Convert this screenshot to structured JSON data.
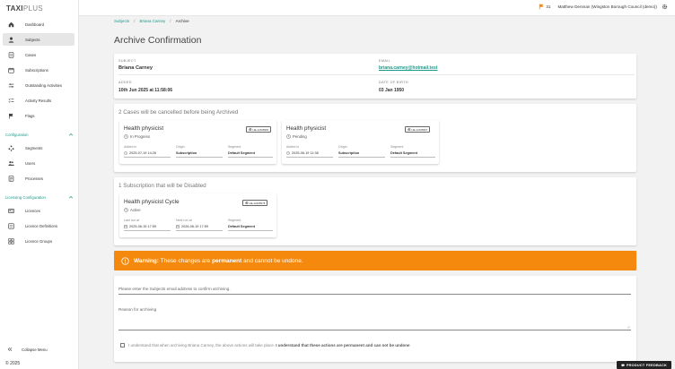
{
  "app": {
    "logo_main": "TAXI",
    "logo_sub": "PLUS",
    "copyright": "© 2025"
  },
  "sidebar": {
    "items": [
      {
        "label": "Dashboard",
        "icon": "home-icon"
      },
      {
        "label": "Subjects",
        "icon": "person-icon",
        "active": true
      },
      {
        "label": "Cases",
        "icon": "folder-icon"
      },
      {
        "label": "Subscriptions",
        "icon": "calendar-icon"
      },
      {
        "label": "Outstanding Activities",
        "icon": "sliders-icon"
      },
      {
        "label": "Activity Results",
        "icon": "list-check-icon"
      },
      {
        "label": "Flags",
        "icon": "flag-icon"
      }
    ],
    "config_section": "Configuration",
    "config_items": [
      {
        "label": "Segments",
        "icon": "segments-icon"
      },
      {
        "label": "Users",
        "icon": "users-icon"
      },
      {
        "label": "Processes",
        "icon": "processes-icon"
      }
    ],
    "licensing_section": "Licensing Configuration",
    "licensing_items": [
      {
        "label": "Licences",
        "icon": "id-card-icon"
      },
      {
        "label": "Licence Definitions",
        "icon": "definitions-icon"
      },
      {
        "label": "Licence Groups",
        "icon": "grid-icon"
      }
    ],
    "collapse_label": "Collapse Menu"
  },
  "topbar": {
    "flag_count": "31",
    "user": "Matthew Denman (Wingston Borough Council (demo))"
  },
  "breadcrumb": {
    "items": [
      "Subjects",
      "Briana Carney",
      "Archive"
    ],
    "sep": "/"
  },
  "page": {
    "title": "Archive Confirmation"
  },
  "subject": {
    "subject_label": "SUBJECT",
    "subject_value": "Briana Carney",
    "email_label": "EMAIL",
    "email_value": "briana.carney@hotmail.test",
    "added_label": "ADDED",
    "added_value": "10th Jun 2025 at 11:58:06",
    "dob_label": "DATE OF BIRTH",
    "dob_value": "03 Jan 1950"
  },
  "cases": {
    "heading": "2 Cases will be cancelled before being Archived",
    "items": [
      {
        "title": "Health physicist",
        "status": "In Progress",
        "id": "HE-12345981",
        "added_label": "Added in",
        "added": "2025-07-19 14:26",
        "origin_label": "Origin",
        "origin": "Subscription",
        "segment_label": "Segment",
        "segment": "Default Segment"
      },
      {
        "title": "Health physicist",
        "status": "Pending",
        "id": "HE-12345967",
        "added_label": "Added in",
        "added": "2025-06-19 11:38",
        "origin_label": "Origin",
        "origin": "Subscription",
        "segment_label": "Segment",
        "segment": "Default Segment"
      }
    ]
  },
  "subscriptions": {
    "heading": "1 Subscription that will be Disabled",
    "items": [
      {
        "title": "Health physicist Cycle",
        "status": "Active",
        "id": "HE-12345678",
        "last_label": "Last run at",
        "last": "2025-06-19 17:59",
        "next_label": "Next run at",
        "next": "2026-06-19 17:59",
        "segment_label": "Segment",
        "segment": "Default Segment"
      }
    ]
  },
  "warning": {
    "prefix": "Warning:",
    "text1": " These changes are ",
    "bold": "permanent",
    "text2": " and cannot be undone."
  },
  "form": {
    "email_prompt": "Please enter the Subjects email address to confirm archiving.",
    "reason_label": "Reason for archiving",
    "checkbox_text": "I understand that when archiving Briana Carney, the above actions will take place.",
    "checkbox_bold": " I understand that these actions are permanent and can not be undone"
  },
  "feedback": {
    "label": "PRODUCT FEEDBACK"
  },
  "colors": {
    "accent": "#1a9a8a",
    "warning": "#f5890e"
  }
}
